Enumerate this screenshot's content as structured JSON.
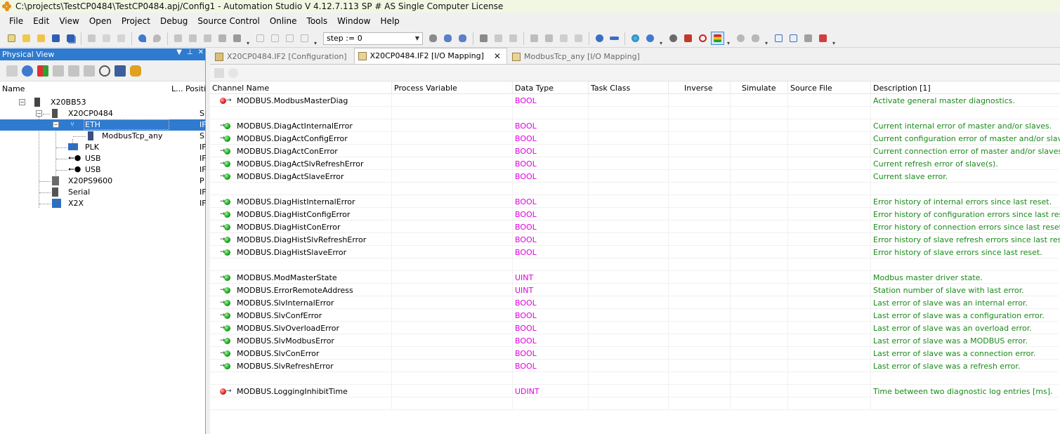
{
  "window": {
    "title": "C:\\projects\\TestCP0484\\TestCP0484.apj/Config1 - Automation Studio V 4.12.7.113 SP # AS Single Computer License"
  },
  "menu": [
    "File",
    "Edit",
    "View",
    "Open",
    "Project",
    "Debug",
    "Source Control",
    "Online",
    "Tools",
    "Window",
    "Help"
  ],
  "toolbar": {
    "step_value": "step := 0"
  },
  "physical_view": {
    "title": "Physical View",
    "col_name": "Name",
    "col_l": "L...",
    "col_position": "Positi",
    "tree": [
      {
        "label": "X20BB53",
        "pos": ""
      },
      {
        "label": "X20CP0484",
        "pos": "S"
      },
      {
        "label": "ETH",
        "pos": "IF",
        "selected": true
      },
      {
        "label": "ModbusTcp_any",
        "pos": "S"
      },
      {
        "label": "PLK",
        "pos": "IF"
      },
      {
        "label": "USB",
        "pos": "IF"
      },
      {
        "label": "USB",
        "pos": "IF"
      },
      {
        "label": "X20PS9600",
        "pos": "P"
      },
      {
        "label": "Serial",
        "pos": "IF"
      },
      {
        "label": "X2X",
        "pos": "IF"
      }
    ]
  },
  "tabs": [
    {
      "label": "X20CP0484.IF2 [Configuration]",
      "active": false
    },
    {
      "label": "X20CP0484.IF2 [I/O Mapping]",
      "active": true
    },
    {
      "label": "ModbusTcp_any [I/O Mapping]",
      "active": false
    }
  ],
  "grid": {
    "columns": [
      "Channel Name",
      "Process Variable",
      "Data Type",
      "Task Class",
      "Inverse",
      "Simulate",
      "Source File",
      "Description [1]"
    ],
    "rows": [
      {
        "dir": "out",
        "name": "MODBUS.ModbusMasterDiag",
        "type": "BOOL",
        "desc": "Activate general master diagnostics."
      },
      {
        "blank": true
      },
      {
        "dir": "in",
        "name": "MODBUS.DiagActInternalError",
        "type": "BOOL",
        "desc": "Current internal error of master and/or slaves."
      },
      {
        "dir": "in",
        "name": "MODBUS.DiagActConfigError",
        "type": "BOOL",
        "desc": "Current configuration error of master and/or slaves."
      },
      {
        "dir": "in",
        "name": "MODBUS.DiagActConError",
        "type": "BOOL",
        "desc": "Current connection error of master and/or slaves."
      },
      {
        "dir": "in",
        "name": "MODBUS.DiagActSlvRefreshError",
        "type": "BOOL",
        "desc": "Current refresh error of slave(s)."
      },
      {
        "dir": "in",
        "name": "MODBUS.DiagActSlaveError",
        "type": "BOOL",
        "desc": "Current slave error."
      },
      {
        "blank": true
      },
      {
        "dir": "in",
        "name": "MODBUS.DiagHistInternalError",
        "type": "BOOL",
        "desc": "Error history of internal errors since last reset."
      },
      {
        "dir": "in",
        "name": "MODBUS.DiagHistConfigError",
        "type": "BOOL",
        "desc": "Error history of configuration errors since last reset."
      },
      {
        "dir": "in",
        "name": "MODBUS.DiagHistConError",
        "type": "BOOL",
        "desc": "Error history of connection errors since last reset."
      },
      {
        "dir": "in",
        "name": "MODBUS.DiagHistSlvRefreshError",
        "type": "BOOL",
        "desc": "Error history of slave refresh errors since last reset."
      },
      {
        "dir": "in",
        "name": "MODBUS.DiagHistSlaveError",
        "type": "BOOL",
        "desc": "Error history of slave errors since last reset."
      },
      {
        "blank": true
      },
      {
        "dir": "in",
        "name": "MODBUS.ModMasterState",
        "type": "UINT",
        "desc": "Modbus master driver state."
      },
      {
        "dir": "in",
        "name": "MODBUS.ErrorRemoteAddress",
        "type": "UINT",
        "desc": "Station number of slave with last error."
      },
      {
        "dir": "in",
        "name": "MODBUS.SlvInternalError",
        "type": "BOOL",
        "desc": "Last error of slave was an internal error."
      },
      {
        "dir": "in",
        "name": "MODBUS.SlvConfError",
        "type": "BOOL",
        "desc": "Last error of slave was a configuration error."
      },
      {
        "dir": "in",
        "name": "MODBUS.SlvOverloadError",
        "type": "BOOL",
        "desc": "Last error of slave was an overload error."
      },
      {
        "dir": "in",
        "name": "MODBUS.SlvModbusError",
        "type": "BOOL",
        "desc": "Last error of slave was a MODBUS error."
      },
      {
        "dir": "in",
        "name": "MODBUS.SlvConError",
        "type": "BOOL",
        "desc": "Last error of slave was a connection error."
      },
      {
        "dir": "in",
        "name": "MODBUS.SlvRefreshError",
        "type": "BOOL",
        "desc": "Last error of slave was a refresh error."
      },
      {
        "blank": true
      },
      {
        "dir": "out",
        "name": "MODBUS.LoggingInhibitTime",
        "type": "UDINT",
        "desc": "Time between two diagnostic log entries [ms]."
      },
      {
        "blank": true
      }
    ]
  },
  "colors": {
    "accent": "#2f7bd0",
    "datatype": "#e000e0",
    "description": "#1a8a1a",
    "input_dot": "#16a016",
    "output_dot": "#e01818"
  }
}
